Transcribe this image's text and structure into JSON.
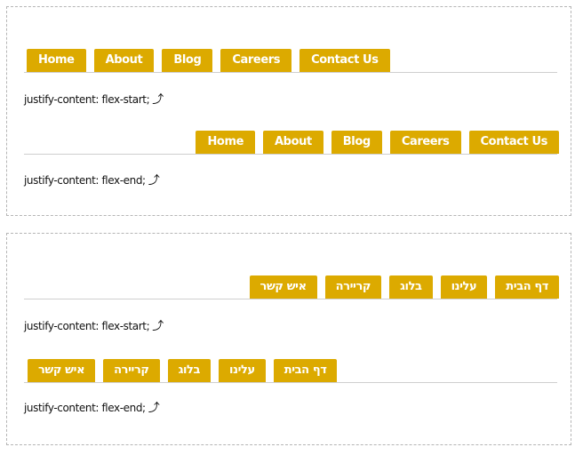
{
  "examples": [
    {
      "direction": "ltr",
      "tabs": [
        "Home",
        "About",
        "Blog",
        "Careers",
        "Contact Us"
      ],
      "start_caption": "justify-content: flex-start;",
      "end_caption": "justify-content: flex-end;"
    },
    {
      "direction": "rtl",
      "tabs": [
        "דף הבית",
        "עלינו",
        "בלוג",
        "קריירה",
        "איש קשר"
      ],
      "start_caption": "justify-content: flex-start;",
      "end_caption": "justify-content: flex-end;"
    }
  ],
  "arrow_icon": "⤴",
  "colors": {
    "tab_bg": "#dcaa00",
    "tab_text": "#ffffff",
    "border": "#cfcfcf",
    "dashed": "#b5b5b5"
  }
}
